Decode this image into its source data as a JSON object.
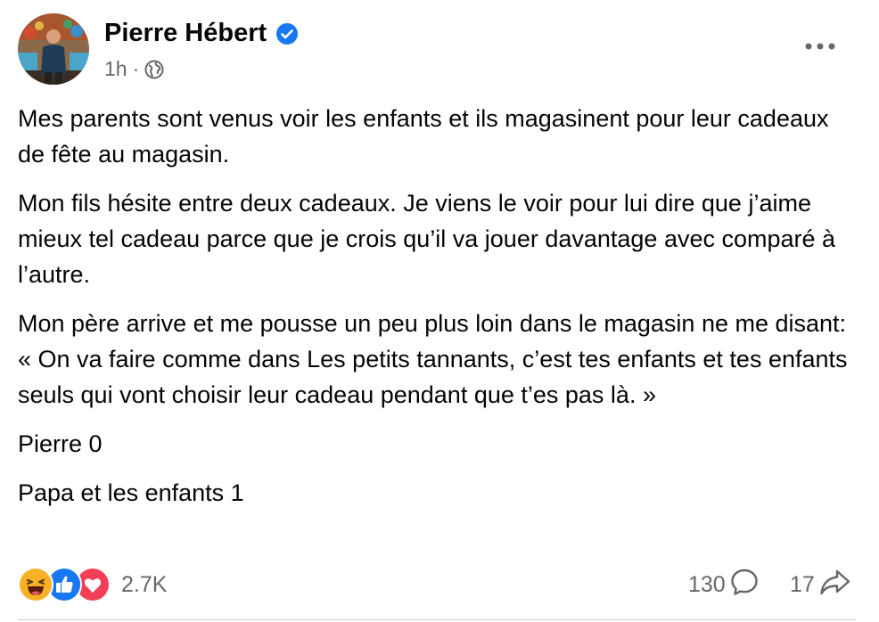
{
  "post": {
    "author": "Pierre Hébert",
    "time": "1h",
    "separator": "·",
    "paragraphs": [
      "Mes parents sont venus voir les enfants et ils magasinent pour leur cadeaux de fête au magasin.",
      "Mon fils hésite entre deux cadeaux. Je viens le voir pour lui dire que j’aime mieux tel cadeau parce que je crois qu’il va jouer davantage avec comparé à l’autre.",
      "Mon père arrive et me pousse un peu plus loin dans le magasin ne me disant:  « On va faire comme dans Les petits tannants, c’est tes enfants et tes enfants seuls qui vont choisir leur cadeau pendant que t’es pas là. »",
      "Pierre 0",
      "Papa et les enfants 1"
    ],
    "reactions_count": "2.7K",
    "comments_count": "130",
    "shares_count": "17"
  },
  "icons": {
    "verified": "verified-badge-icon",
    "audience": "globe-icon",
    "more": "more-options-icon",
    "reactions": [
      "haha-reaction-icon",
      "like-reaction-icon",
      "love-reaction-icon"
    ],
    "comment": "comment-icon",
    "share": "share-icon"
  },
  "colors": {
    "verified_blue": "#1877f2",
    "secondary_text": "#65676b",
    "like_blue": "#1877f2",
    "love_red": "#f33e58",
    "haha_yellow": "#f7b125"
  }
}
